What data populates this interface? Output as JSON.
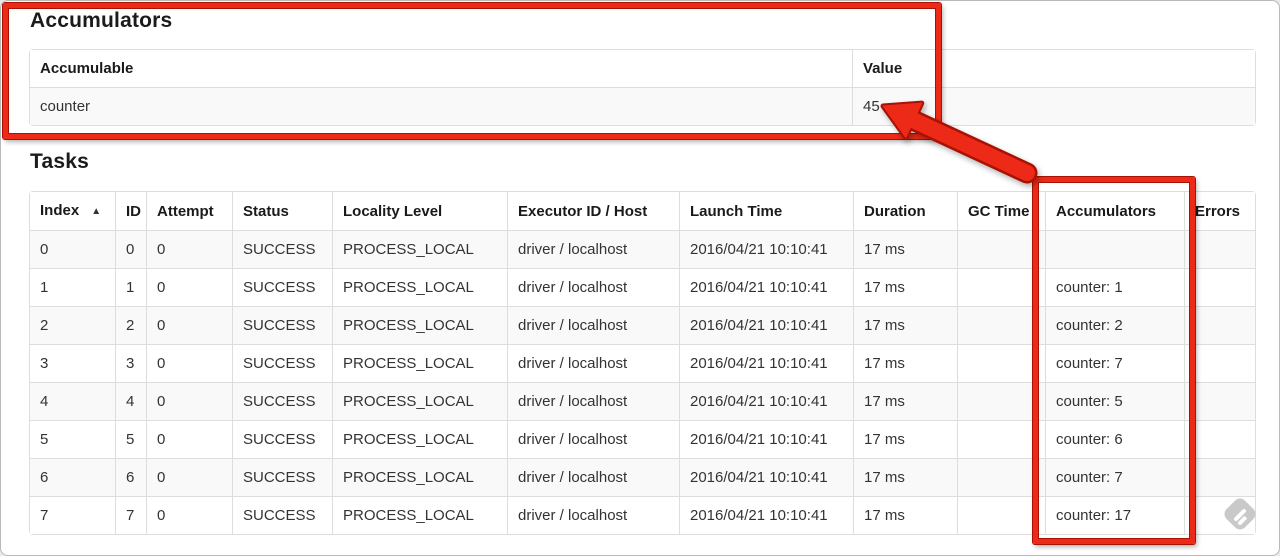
{
  "accumulators_section": {
    "title": "Accumulators"
  },
  "tasks_section": {
    "title": "Tasks"
  },
  "tables": {
    "accumulators": {
      "headers": [
        "Accumulable",
        "Value"
      ],
      "rows": [
        [
          "counter",
          "45"
        ]
      ]
    },
    "tasks": {
      "headers": [
        "Index",
        "ID",
        "Attempt",
        "Status",
        "Locality Level",
        "Executor ID / Host",
        "Launch Time",
        "Duration",
        "GC Time",
        "Accumulators",
        "Errors"
      ],
      "sort": {
        "column": 0,
        "glyph": "▲",
        "direction": "ascending"
      },
      "rows": [
        [
          "0",
          "0",
          "0",
          "SUCCESS",
          "PROCESS_LOCAL",
          "driver / localhost",
          "2016/04/21 10:10:41",
          "17 ms",
          "",
          "",
          ""
        ],
        [
          "1",
          "1",
          "0",
          "SUCCESS",
          "PROCESS_LOCAL",
          "driver / localhost",
          "2016/04/21 10:10:41",
          "17 ms",
          "",
          "counter: 1",
          ""
        ],
        [
          "2",
          "2",
          "0",
          "SUCCESS",
          "PROCESS_LOCAL",
          "driver / localhost",
          "2016/04/21 10:10:41",
          "17 ms",
          "",
          "counter: 2",
          ""
        ],
        [
          "3",
          "3",
          "0",
          "SUCCESS",
          "PROCESS_LOCAL",
          "driver / localhost",
          "2016/04/21 10:10:41",
          "17 ms",
          "",
          "counter: 7",
          ""
        ],
        [
          "4",
          "4",
          "0",
          "SUCCESS",
          "PROCESS_LOCAL",
          "driver / localhost",
          "2016/04/21 10:10:41",
          "17 ms",
          "",
          "counter: 5",
          ""
        ],
        [
          "5",
          "5",
          "0",
          "SUCCESS",
          "PROCESS_LOCAL",
          "driver / localhost",
          "2016/04/21 10:10:41",
          "17 ms",
          "",
          "counter: 6",
          ""
        ],
        [
          "6",
          "6",
          "0",
          "SUCCESS",
          "PROCESS_LOCAL",
          "driver / localhost",
          "2016/04/21 10:10:41",
          "17 ms",
          "",
          "counter: 7",
          ""
        ],
        [
          "7",
          "7",
          "0",
          "SUCCESS",
          "PROCESS_LOCAL",
          "driver / localhost",
          "2016/04/21 10:10:41",
          "17 ms",
          "",
          "counter: 17",
          ""
        ]
      ]
    }
  },
  "colors": {
    "annotation_red": "#ed2a18",
    "annotation_red_dark": "#a81103",
    "row_stripe": "#f9f9f9",
    "table_border": "#dddddd",
    "watermark_gray": "#c9c9c9"
  }
}
